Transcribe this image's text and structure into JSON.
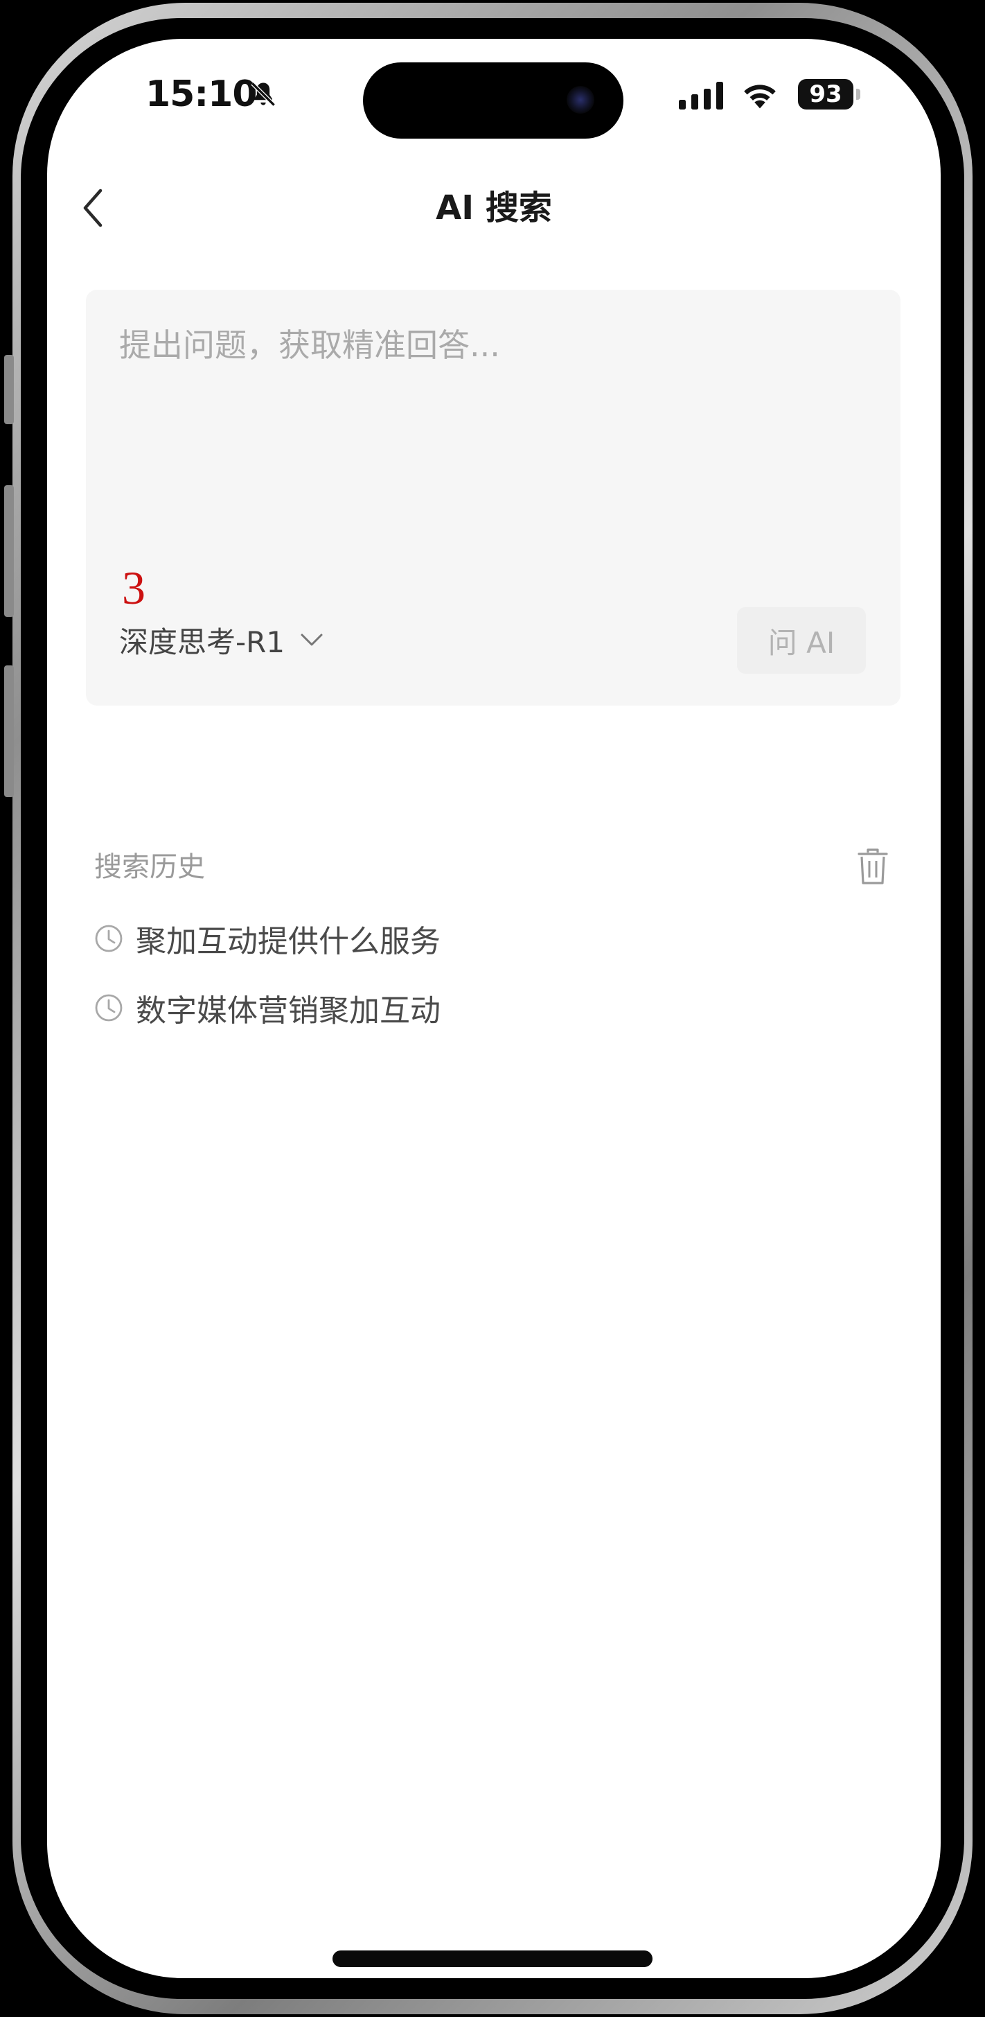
{
  "status_bar": {
    "time": "15:10",
    "battery_level": "93",
    "icons": [
      "bell-off-icon",
      "signal-icon",
      "wifi-icon",
      "battery-icon"
    ]
  },
  "header": {
    "title": "AI 搜索",
    "back_icon": "chevron-left-icon"
  },
  "query_box": {
    "placeholder": "提出问题，获取精准回答...",
    "annotation": "3",
    "model_selector": {
      "label": "深度思考-R1",
      "icon": "chevron-down-icon"
    },
    "ask_button_label": "问 AI"
  },
  "history": {
    "title": "搜索历史",
    "clear_icon": "trash-icon",
    "items": [
      {
        "text": "聚加互动提供什么服务",
        "icon": "clock-icon"
      },
      {
        "text": "数字媒体营销聚加互动",
        "icon": "clock-icon"
      }
    ]
  },
  "colors": {
    "annotation": "#cc1111",
    "card_background": "#f6f6f6",
    "placeholder": "#aaaaaa",
    "muted_text": "#9a9a9a"
  }
}
